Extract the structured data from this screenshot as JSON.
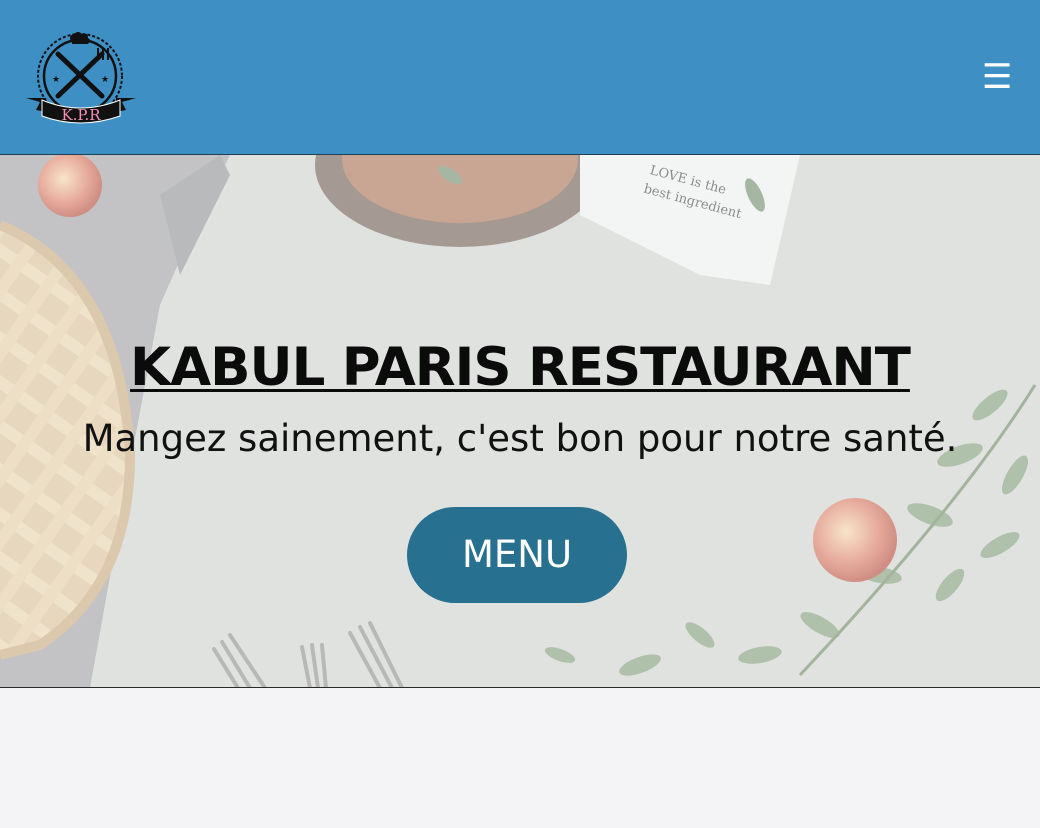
{
  "header": {
    "logo_text": "K.P.R",
    "menu_icon": "hamburger-menu-icon",
    "menu_glyph": "☰"
  },
  "hero": {
    "title": "KABUL PARIS RESTAURANT",
    "subtitle": "Mangez sainement, c'est bon pour notre santé.",
    "menu_button_label": "MENU",
    "napkin_text_line1": "LOVE is the",
    "napkin_text_line2": "best ingredient"
  },
  "colors": {
    "header_bg": "#3e8fc4",
    "button_bg": "#27708f",
    "page_bg": "#f4f4f6"
  }
}
